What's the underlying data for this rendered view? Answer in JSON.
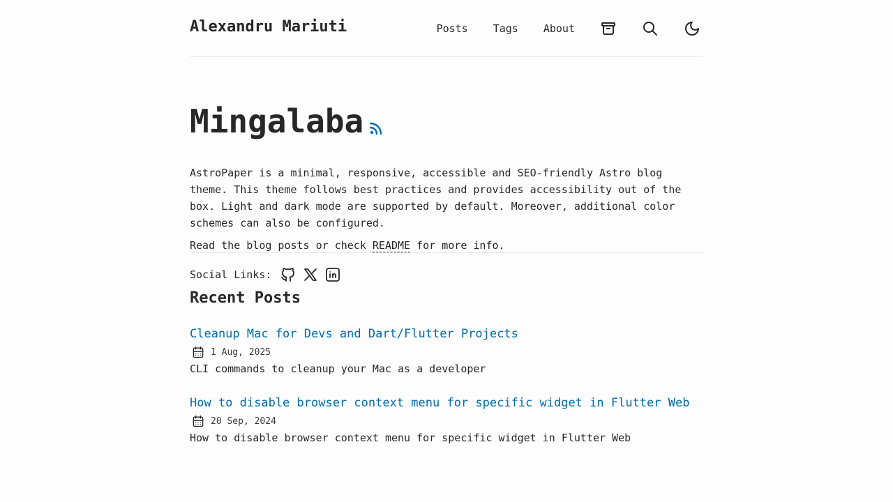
{
  "header": {
    "site_title": "Alexandru Mariuti",
    "nav": {
      "posts": "Posts",
      "tags": "Tags",
      "about": "About"
    },
    "icons": [
      "archive-icon",
      "search-icon",
      "moon-icon"
    ]
  },
  "hero": {
    "title": "Mingalaba",
    "intro": "AstroPaper is a minimal, responsive, accessible and SEO-friendly Astro blog theme. This theme follows best practices and provides accessibility out of the box. Light and dark mode are supported by default. Moreover, additional color schemes can also be configured.",
    "read_prefix": "Read the blog posts or check ",
    "readme_label": "README",
    "read_suffix": " for more info.",
    "social_label": "Social Links:",
    "social_icons": [
      "github-icon",
      "x-icon",
      "linkedin-icon"
    ]
  },
  "recent": {
    "title": "Recent Posts",
    "posts": [
      {
        "title": "Cleanup Mac for Devs and Dart/Flutter Projects",
        "date": "1 Aug, 2025",
        "description": "CLI commands to cleanup your Mac as a developer"
      },
      {
        "title": "How to disable browser context menu for specific widget in Flutter Web",
        "date": "20 Sep, 2024",
        "description": "How to disable browser context menu for specific widget in Flutter Web"
      }
    ]
  },
  "colors": {
    "accent": "#006cac",
    "text": "#282728",
    "background": "#fdfdfd",
    "border": "#e6e6e6"
  }
}
